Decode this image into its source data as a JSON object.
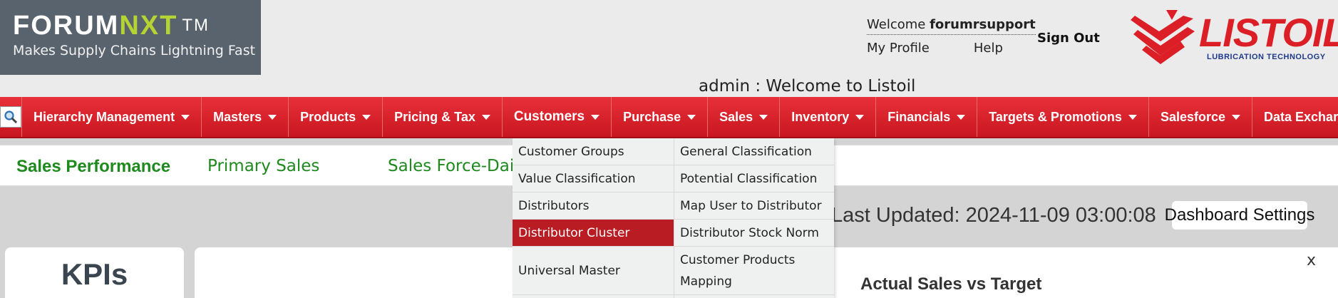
{
  "header": {
    "logo": {
      "title_main": "FORUM",
      "title_accent": "NXT",
      "trademark": "TM",
      "tagline": "Makes Supply Chains Lightning Fast"
    },
    "welcome_prefix": "Welcome",
    "username": "forumrsupport",
    "my_profile": "My Profile",
    "help": "Help",
    "sign_out": "Sign Out",
    "brand": {
      "name": "LISTOIL",
      "tagline": "LUBRICATION TECHNOLOGY",
      "color": "#dc1f26"
    },
    "admin_line": "admin : Welcome to Listoil"
  },
  "nav": {
    "search_icon": "search-icon",
    "items": [
      {
        "label": "Hierarchy Management"
      },
      {
        "label": "Masters"
      },
      {
        "label": "Products"
      },
      {
        "label": "Pricing & Tax"
      },
      {
        "label": "Customers",
        "active": true
      },
      {
        "label": "Purchase"
      },
      {
        "label": "Sales"
      },
      {
        "label": "Inventory"
      },
      {
        "label": "Financials"
      },
      {
        "label": "Targets & Promotions"
      },
      {
        "label": "Salesforce"
      },
      {
        "label": "Data Exchar"
      }
    ]
  },
  "tabs": [
    {
      "label": "Sales Performance",
      "active": true
    },
    {
      "label": "Primary Sales"
    },
    {
      "label": "Sales Force-Daily"
    }
  ],
  "dashboard": {
    "last_updated": "Last Updated: 2024-11-09 03:00:08",
    "settings_button": "Dashboard Settings",
    "kpi_title": "KPIs",
    "chart_title": "Actual Sales vs Target",
    "close_label": "x"
  },
  "dropdown": {
    "left": [
      {
        "label": "Customer Groups"
      },
      {
        "label": "Value Classification"
      },
      {
        "label": "Distributors"
      },
      {
        "label": "Distributor Cluster",
        "highlighted": true
      },
      {
        "label": "Universal Master"
      }
    ],
    "right": [
      {
        "label": "General Classification"
      },
      {
        "label": "Potential Classification"
      },
      {
        "label": "Map User to Distributor"
      },
      {
        "label": "Distributor Stock Norm"
      },
      {
        "label": "Customer Products Mapping"
      }
    ]
  },
  "colors": {
    "nav_red": "#d62029",
    "highlight_red": "#b91c22",
    "tab_green": "#1e8a1e",
    "logo_bg": "#59636d",
    "logo_accent": "#b5d334"
  }
}
